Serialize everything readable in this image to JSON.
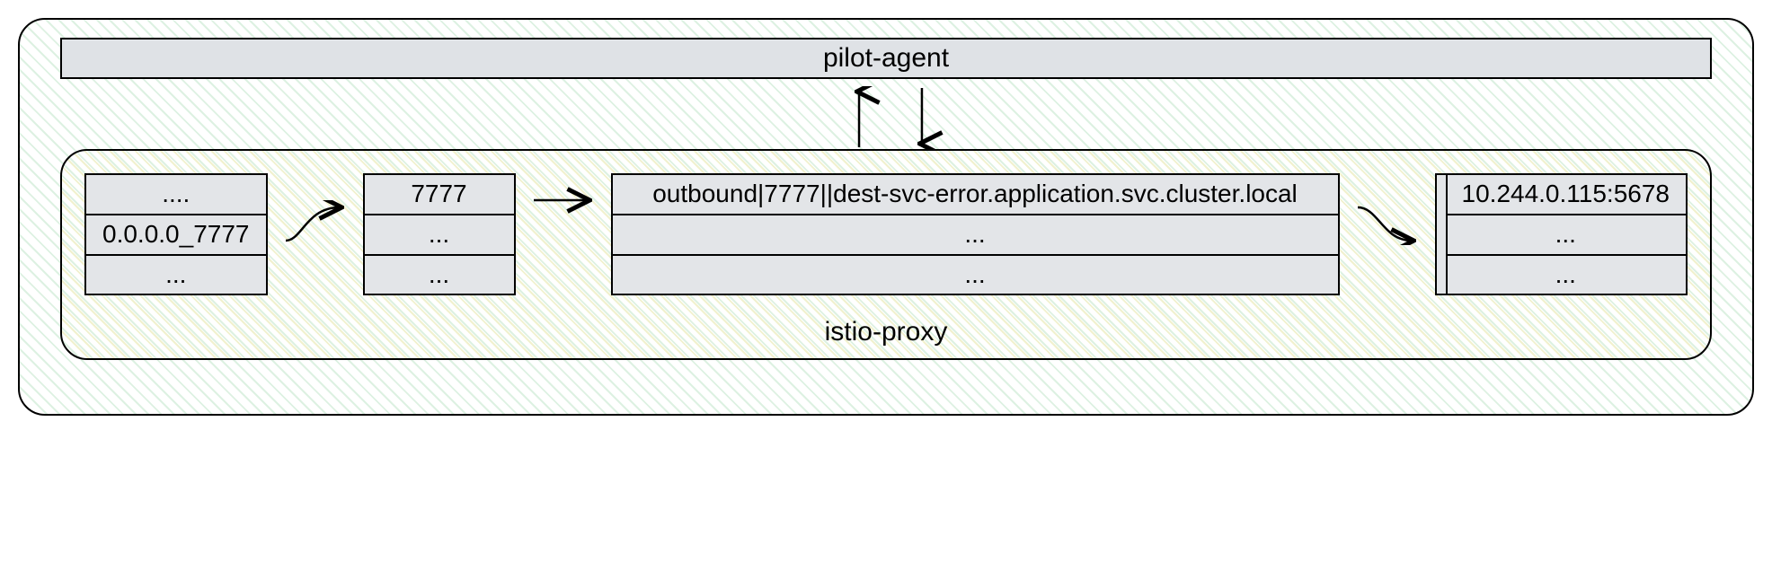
{
  "outer": {
    "title": "pilot-agent"
  },
  "inner": {
    "title": "istio-proxy"
  },
  "listener_table": {
    "r0": "....",
    "r1": "0.0.0.0_7777",
    "r2": "..."
  },
  "port_table": {
    "r0": "7777",
    "r1": "...",
    "r2": "..."
  },
  "cluster_table": {
    "r0": "outbound|7777||dest-svc-error.application.svc.cluster.local",
    "r1": "...",
    "r2": "..."
  },
  "endpoint_table": {
    "r0": "10.244.0.115:5678",
    "r1": "...",
    "r2": "..."
  }
}
